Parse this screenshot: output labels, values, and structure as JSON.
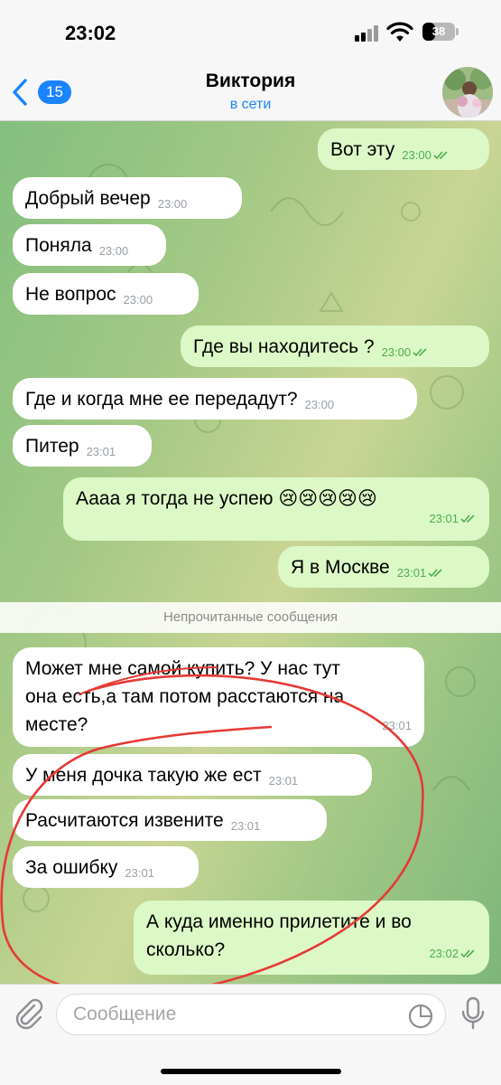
{
  "status_bar": {
    "time": "23:02",
    "battery": "38",
    "battery_level": 0.38
  },
  "header": {
    "back_count": "15",
    "contact_name": "Виктория",
    "contact_status": "в сети"
  },
  "messages": [
    {
      "dir": "out",
      "text": "Вот эту",
      "time": "23:00",
      "read": true
    },
    {
      "dir": "in",
      "text": "Добрый вечер",
      "time": "23:00"
    },
    {
      "dir": "in",
      "text": "Поняла",
      "time": "23:00"
    },
    {
      "dir": "in",
      "text": "Не вопрос",
      "time": "23:00"
    },
    {
      "dir": "out",
      "text": "Где вы находитесь ?",
      "time": "23:00",
      "read": true
    },
    {
      "dir": "in",
      "text": "Где и когда мне ее передадут?",
      "time": "23:00"
    },
    {
      "dir": "in",
      "text": "Питер",
      "time": "23:01"
    },
    {
      "dir": "out",
      "text": "Аааа я тогда не успею 😢😢😢😢😢",
      "time": "23:01",
      "read": true
    },
    {
      "dir": "out",
      "text": "Я в Москве",
      "time": "23:01",
      "read": true
    },
    {
      "dir": "in",
      "text": "Может мне самой купить? У нас тут\nона есть,а там потом расстаются на\nместе?",
      "time": "23:01"
    },
    {
      "dir": "in",
      "text": "У меня дочка такую же ест",
      "time": "23:01"
    },
    {
      "dir": "in",
      "text": "Расчитаются извените",
      "time": "23:01"
    },
    {
      "dir": "in",
      "text": "За ошибку",
      "time": "23:01"
    },
    {
      "dir": "out",
      "text": "А куда именно прилетите и во\nсколько?",
      "time": "23:02",
      "read": true
    }
  ],
  "unread_divider": "Непрочитанные сообщения",
  "input": {
    "placeholder": "Сообщение",
    "value": ""
  },
  "icons": {
    "back": "chevron-left-icon",
    "attach": "paperclip-icon",
    "sticker": "sticker-icon",
    "mic": "microphone-icon",
    "read_receipt": "double-check-icon"
  },
  "colors": {
    "accent": "#1a84ff",
    "outgoing_bubble": "#dcf8c6",
    "incoming_bubble": "#ffffff",
    "read_ticks": "#4caf50",
    "annotation": "#e53935"
  }
}
